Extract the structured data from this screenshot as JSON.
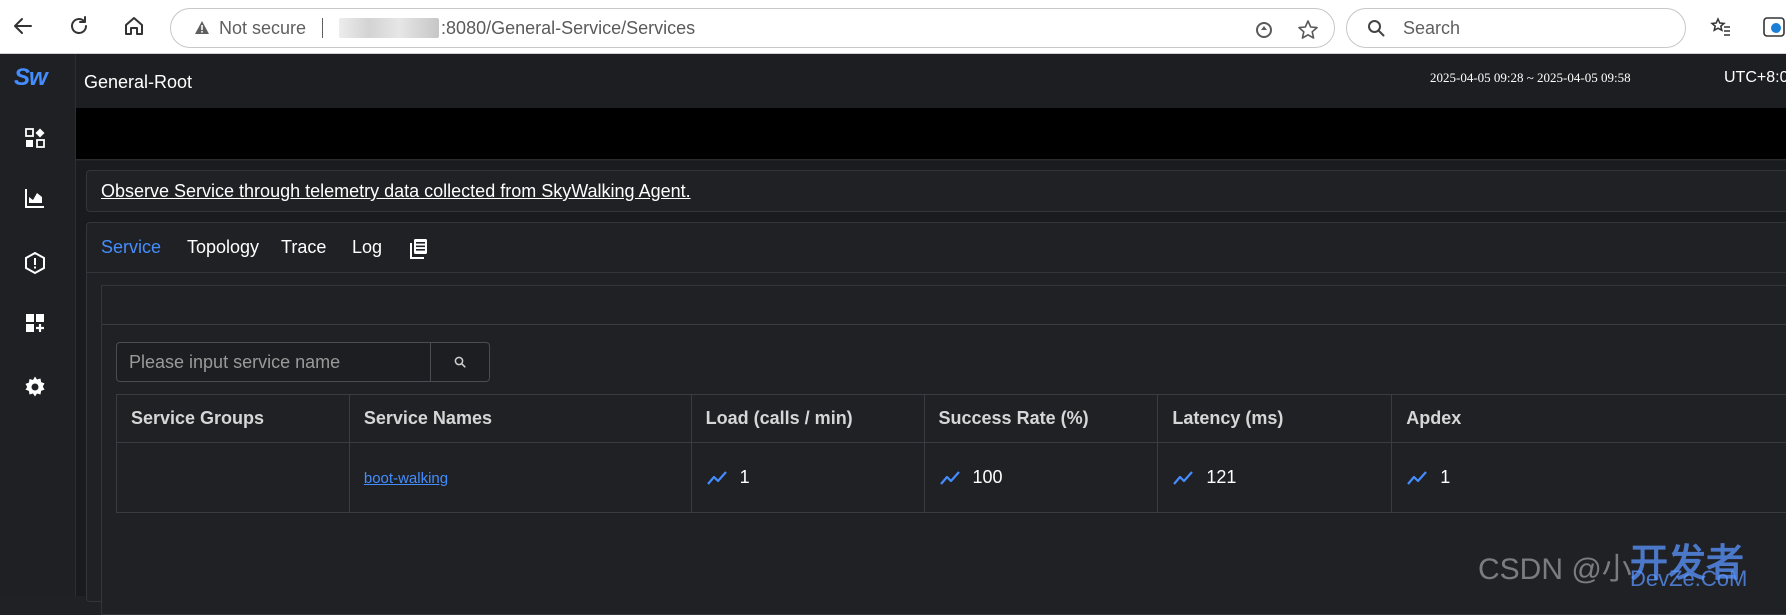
{
  "browser": {
    "security_label": "Not secure",
    "url": ":8080/General-Service/Services",
    "search_placeholder": "Search"
  },
  "app": {
    "logo": "Sw",
    "page_title": "General-Root",
    "time_range": "2025-04-05 09:28 ~ 2025-04-05 09:58",
    "timezone": "UTC+8:0",
    "description": "Observe Service through telemetry data collected from SkyWalking Agent."
  },
  "tabs": [
    {
      "label": "Service"
    },
    {
      "label": "Topology"
    },
    {
      "label": "Trace"
    },
    {
      "label": "Log"
    }
  ],
  "search": {
    "placeholder": "Please input service name"
  },
  "table": {
    "headers": [
      "Service Groups",
      "Service Names",
      "Load (calls / min)",
      "Success Rate (%)",
      "Latency (ms)",
      "Apdex"
    ],
    "rows": [
      {
        "group": "",
        "name": "boot-walking",
        "load": "1",
        "success_rate": "100",
        "latency": "121",
        "apdex": "1"
      }
    ]
  },
  "watermark": {
    "csdn": "CSDN @小",
    "devze_top": "开发者",
    "devze_bottom": "DevZe.CoM"
  },
  "colors": {
    "accent": "#448dfe",
    "background": "#202124"
  }
}
